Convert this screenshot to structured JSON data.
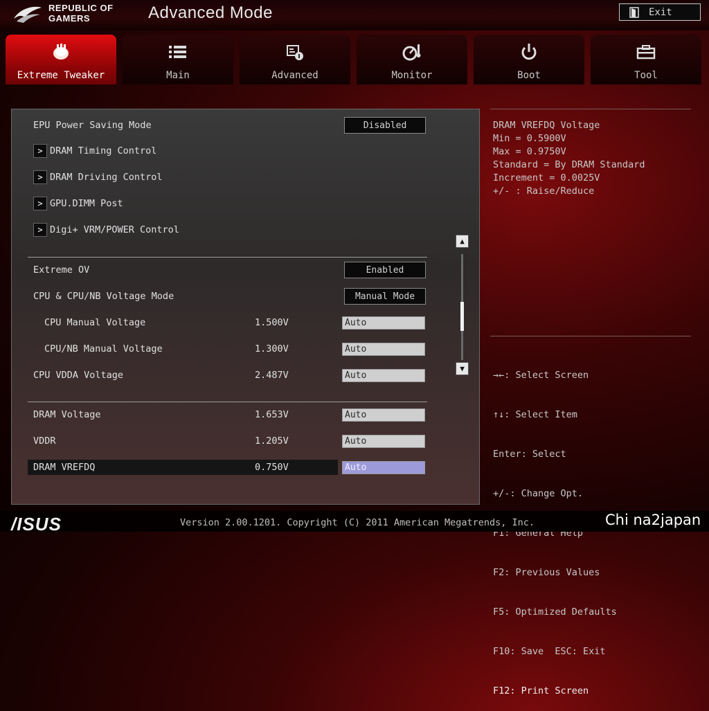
{
  "header": {
    "brand_line1": "REPUBLIC OF",
    "brand_line2": "GAMERS",
    "title": "Advanced Mode",
    "exit_label": "Exit"
  },
  "tabs": [
    {
      "label": "Extreme Tweaker",
      "icon": "tweaker-icon",
      "active": true
    },
    {
      "label": "Main",
      "icon": "list-icon"
    },
    {
      "label": "Advanced",
      "icon": "advanced-icon"
    },
    {
      "label": "Monitor",
      "icon": "monitor-gauge-icon"
    },
    {
      "label": "Boot",
      "icon": "power-icon"
    },
    {
      "label": "Tool",
      "icon": "toolbox-icon"
    }
  ],
  "settings": {
    "epu": {
      "label": "EPU Power Saving Mode",
      "value": "Disabled"
    },
    "submenus": [
      "DRAM Timing Control",
      "DRAM Driving Control",
      "GPU.DIMM Post",
      "Digi+ VRM/POWER Control"
    ],
    "extreme_ov": {
      "label": "Extreme OV",
      "value": "Enabled"
    },
    "voltage_mode": {
      "label": "CPU & CPU/NB Voltage Mode",
      "value": "Manual Mode"
    },
    "cpu_manual": {
      "label": "CPU Manual Voltage",
      "reading": "1.500V",
      "value": "Auto"
    },
    "cpunb_manual": {
      "label": "CPU/NB Manual Voltage",
      "reading": "1.300V",
      "value": "Auto"
    },
    "cpu_vdda": {
      "label": "CPU VDDA Voltage",
      "reading": "2.487V",
      "value": "Auto"
    },
    "dram_voltage": {
      "label": "DRAM Voltage",
      "reading": "1.653V",
      "value": "Auto"
    },
    "vddr": {
      "label": "VDDR",
      "reading": "1.205V",
      "value": "Auto"
    },
    "dram_vrefdq": {
      "label": "DRAM VREFDQ",
      "reading": "0.750V",
      "value": "Auto"
    }
  },
  "help": {
    "description": "DRAM VREFDQ Voltage\nMin = 0.5900V\nMax = 0.9750V\nStandard = By DRAM Standard\nIncrement = 0.0025V\n+/- : Raise/Reduce",
    "keys": [
      "→←: Select Screen",
      "↑↓: Select Item",
      "Enter: Select",
      "+/-: Change Opt.",
      "F1: General Help",
      "F2: Previous Values",
      "F5: Optimized Defaults",
      "F10: Save  ESC: Exit",
      "F12: Print Screen"
    ]
  },
  "footer": {
    "brand": "/ISUS",
    "version": "Version 2.00.1201. Copyright (C) 2011 American Megatrends, Inc.",
    "watermark": "Chi na2japan"
  },
  "colors": {
    "accent": "#e10c10",
    "selected_field": "#9c9ad8",
    "background": "#3a0405"
  }
}
